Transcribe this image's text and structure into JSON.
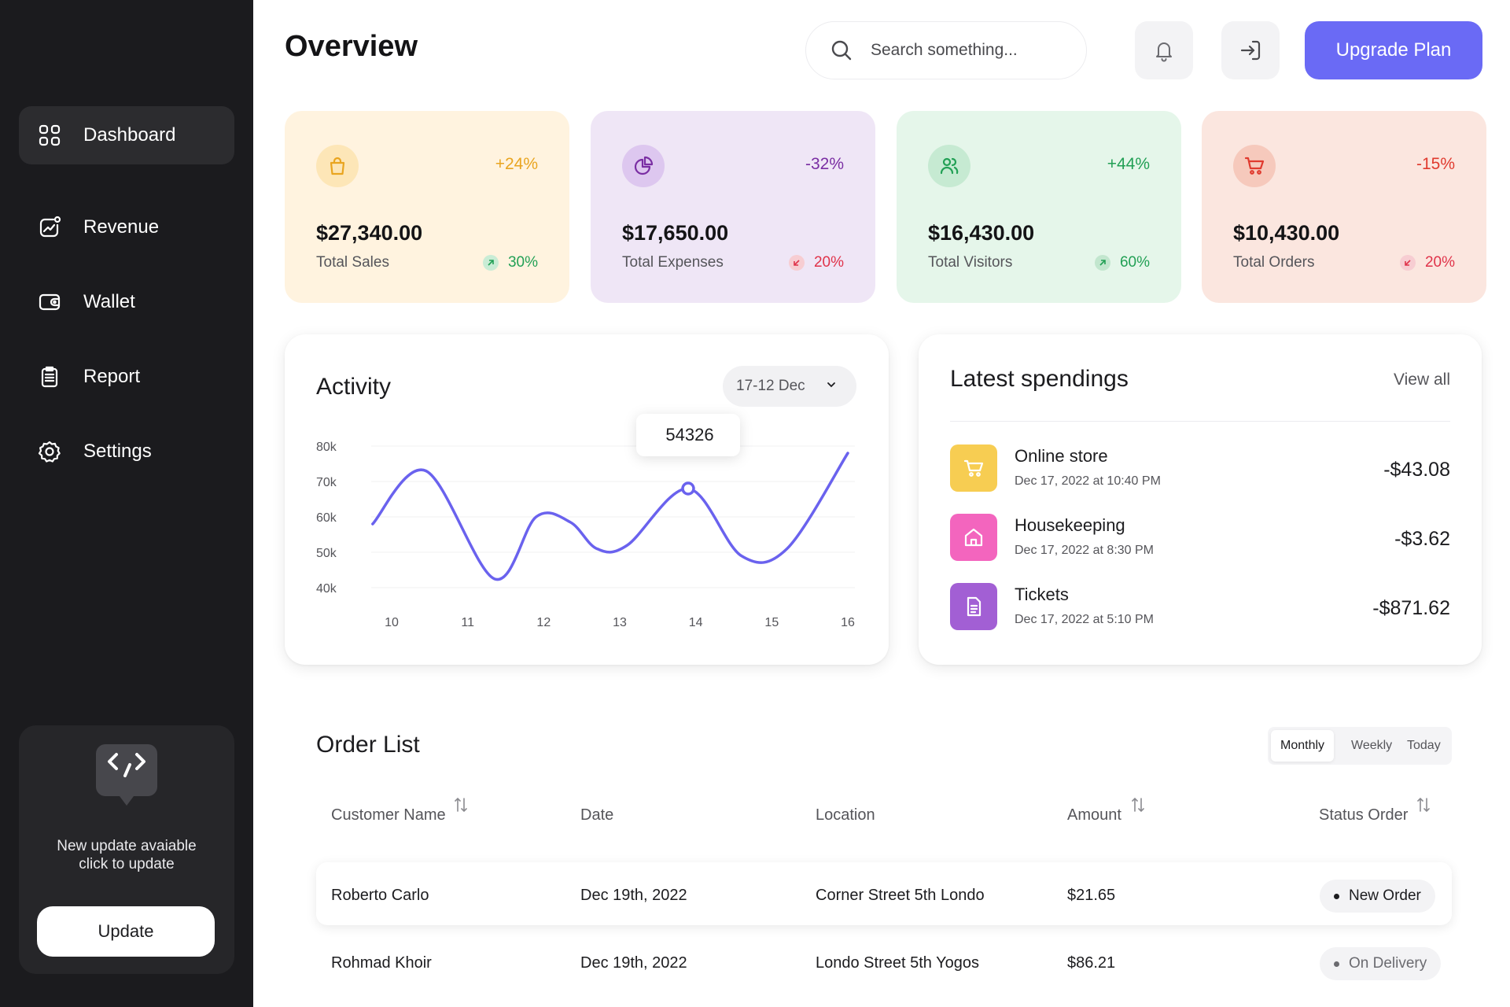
{
  "sidebar": {
    "items": [
      {
        "label": "Dashboard",
        "icon": "grid-icon",
        "active": true
      },
      {
        "label": "Revenue",
        "icon": "trend-chart-icon"
      },
      {
        "label": "Wallet",
        "icon": "wallet-icon"
      },
      {
        "label": "Report",
        "icon": "clipboard-icon"
      },
      {
        "label": "Settings",
        "icon": "gear-icon"
      }
    ],
    "promo": {
      "line1": "New update avaiable",
      "line2": "click to update",
      "button": "Update",
      "icon": "code-bubble-icon"
    }
  },
  "header": {
    "title": "Overview",
    "search_placeholder": "Search something...",
    "upgrade_label": "Upgrade Plan"
  },
  "stats": [
    {
      "value": "$27,340.00",
      "label": "Total Sales",
      "pct": "+24%",
      "trend": "30%",
      "direction": "up",
      "icon": "shopping-bag-icon",
      "bg": "#fff3df",
      "accent": "#e9a520",
      "icon_bg": "#fde6b7"
    },
    {
      "value": "$17,650.00",
      "label": "Total Expenses",
      "pct": "-32%",
      "trend": "20%",
      "direction": "down",
      "icon": "pie-chart-icon",
      "bg": "#efe6f6",
      "accent": "#7a2ea3",
      "icon_bg": "#ddc7ef"
    },
    {
      "value": "$16,430.00",
      "label": "Total Visitors",
      "pct": "+44%",
      "trend": "60%",
      "direction": "up",
      "icon": "users-icon",
      "bg": "#e5f6ea",
      "accent": "#22a055",
      "icon_bg": "#c6ead2"
    },
    {
      "value": "$10,430.00",
      "label": "Total Orders",
      "pct": "-15%",
      "trend": "20%",
      "direction": "down",
      "icon": "cart-icon",
      "bg": "#fbe6df",
      "accent": "#e03a2e",
      "icon_bg": "#f6c9bc"
    }
  ],
  "activity": {
    "title": "Activity",
    "range": "17-12 Dec",
    "tooltip": "54326"
  },
  "chart_data": {
    "type": "line",
    "x": [
      10,
      11,
      12,
      13,
      14,
      15,
      16
    ],
    "ylim": [
      40000,
      80000
    ],
    "y_ticks": [
      "80k",
      "70k",
      "60k",
      "50k",
      "40k"
    ],
    "points": [
      [
        9.75,
        58000
      ],
      [
        10.45,
        73000
      ],
      [
        11.35,
        42500
      ],
      [
        11.9,
        60000
      ],
      [
        12.35,
        58500
      ],
      [
        12.7,
        51000
      ],
      [
        13.1,
        52000
      ],
      [
        13.9,
        68000
      ],
      [
        14.6,
        49000
      ],
      [
        15.2,
        51000
      ],
      [
        16.0,
        78000
      ]
    ],
    "highlight": {
      "x": 13.9,
      "y": 54326
    },
    "color": "#6a62ee"
  },
  "spendings": {
    "title": "Latest spendings",
    "view_all": "View all",
    "items": [
      {
        "name": "Online store",
        "date": "Dec 17, 2022 at 10:40 PM",
        "amount": "-$43.08",
        "icon": "cart-icon",
        "color": "#f7cd52"
      },
      {
        "name": "Housekeeping",
        "date": "Dec 17, 2022 at 8:30 PM",
        "amount": "-$3.62",
        "icon": "home-icon",
        "color": "#f365be"
      },
      {
        "name": "Tickets",
        "date": "Dec 17, 2022 at 5:10 PM",
        "amount": "-$871.62",
        "icon": "document-icon",
        "color": "#a25fd4"
      }
    ]
  },
  "orders": {
    "title": "Order List",
    "tabs": [
      "Monthly",
      "Weekly",
      "Today"
    ],
    "columns": [
      "Customer Name",
      "Date",
      "Location",
      "Amount",
      "Status Order"
    ],
    "rows": [
      {
        "customer": "Roberto Carlo",
        "date": "Dec 19th, 2022",
        "location": "Corner Street 5th Londo",
        "amount": "$21.65",
        "status": "New Order"
      },
      {
        "customer": "Rohmad Khoir",
        "date": "Dec 19th, 2022",
        "location": "Londo Street 5th Yogos",
        "amount": "$86.21",
        "status": "On Delivery"
      }
    ]
  }
}
